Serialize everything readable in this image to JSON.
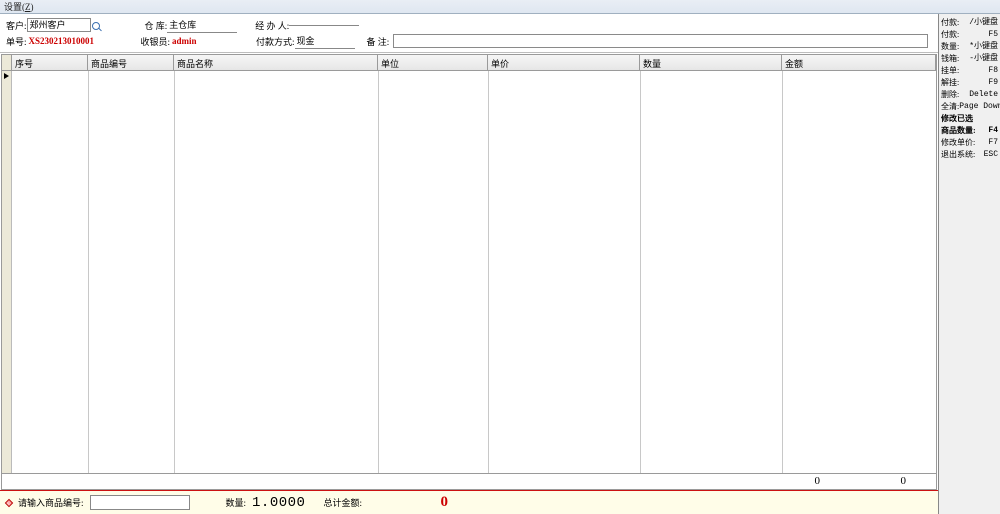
{
  "menu": {
    "settings_label": "设置(Z)"
  },
  "form": {
    "customer_label": "客户:",
    "customer_value": "郑州客户",
    "orderno_label": "单号:",
    "orderno_value": "XS230213010001",
    "warehouse_label": "仓  库:",
    "warehouse_value": "主仓库",
    "cashier_label": "收银员:",
    "cashier_value": "admin",
    "handler_label": "经 办 人:",
    "handler_value": "",
    "paymethod_label": "付款方式:",
    "paymethod_value": "现金",
    "remarks_label": "备    注:"
  },
  "grid": {
    "headers": [
      "序号",
      "商品编号",
      "商品名称",
      "单位",
      "单价",
      "数量",
      "金额"
    ],
    "footer_qty": "0",
    "footer_amount": "0"
  },
  "inputbar": {
    "prompt": "请输入商品编号:",
    "qty_label": "数量:",
    "qty_value": "1.0000",
    "total_label": "总计金额:",
    "total_value": "0"
  },
  "sidebar": [
    {
      "k": "付款:",
      "v": "/小键盘",
      "strong": false
    },
    {
      "k": "付款:",
      "v": "F5",
      "strong": false
    },
    {
      "k": "数量:",
      "v": "*小键盘",
      "strong": false
    },
    {
      "k": "钱箱:",
      "v": "-小键盘",
      "strong": false
    },
    {
      "k": "挂单:",
      "v": "F8",
      "strong": false
    },
    {
      "k": "解挂:",
      "v": "F9",
      "strong": false
    },
    {
      "k": "删除:",
      "v": "Delete",
      "strong": false
    },
    {
      "k": "全清:",
      "v": "Page Down",
      "strong": false
    },
    {
      "k": "修改已选",
      "v": "",
      "strong": true
    },
    {
      "k": "商品数量:",
      "v": "F4",
      "strong": true
    },
    {
      "k": "修改单价:",
      "v": "F7",
      "strong": false
    },
    {
      "k": "退出系统:",
      "v": "ESC",
      "strong": false
    }
  ]
}
